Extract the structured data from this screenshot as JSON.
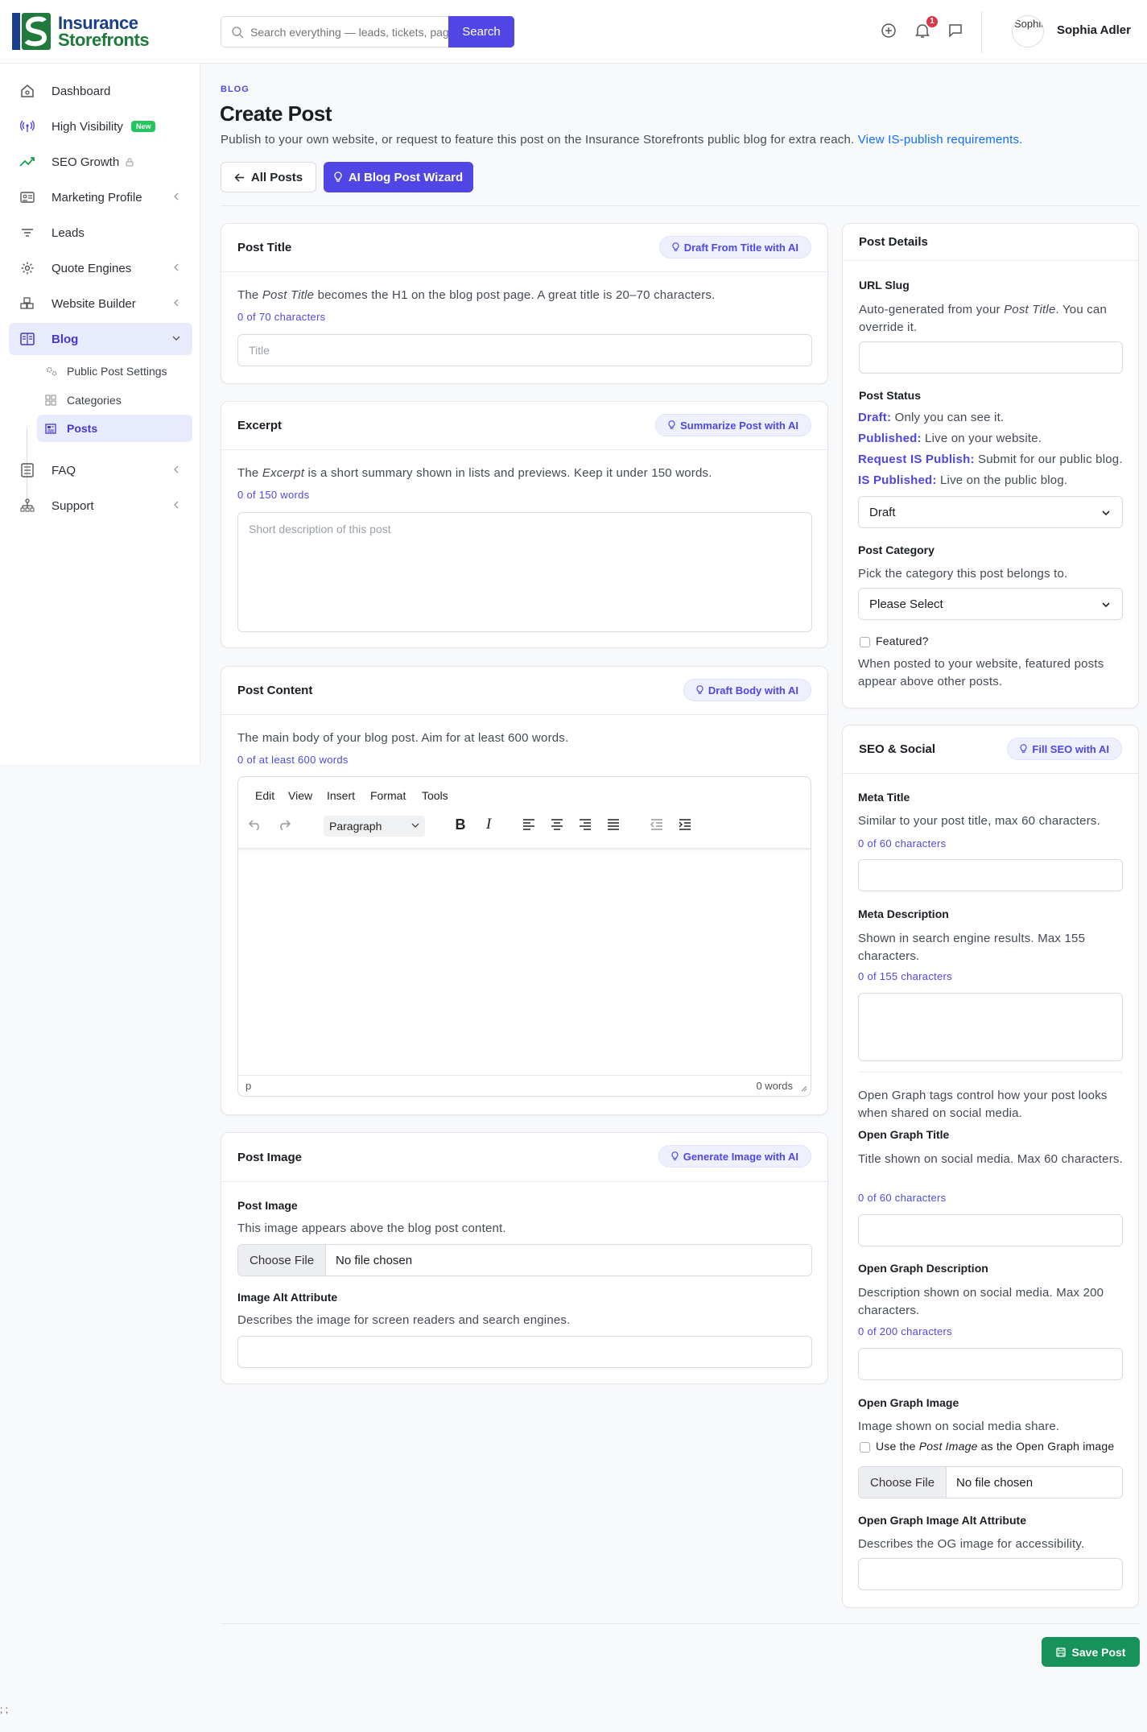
{
  "brand": {
    "line1": "Insurance",
    "line2": "Storefronts",
    "colors": {
      "primary": "#4f46e5",
      "success": "#16925a",
      "danger": "#dc3545"
    }
  },
  "search": {
    "placeholder": "Search everything — leads, tickets, pages...",
    "button": "Search"
  },
  "header": {
    "notification_count": "1",
    "user_name": "Sophia Adler",
    "avatar_alt": "Sophia"
  },
  "sidebar": {
    "items": [
      {
        "label": "Dashboard",
        "icon": "home-icon"
      },
      {
        "label": "High Visibility",
        "icon": "broadcast-icon",
        "badge": "New"
      },
      {
        "label": "SEO Growth",
        "icon": "trending-up-icon"
      },
      {
        "label": "Marketing Profile",
        "icon": "id-card-icon"
      },
      {
        "label": "Leads",
        "icon": "filter-icon"
      },
      {
        "label": "Quote Engines",
        "icon": "gear-icon"
      },
      {
        "label": "Website Builder",
        "icon": "cubes-icon"
      },
      {
        "label": "Blog",
        "icon": "book-icon"
      },
      {
        "label": "FAQ",
        "icon": "list-icon"
      },
      {
        "label": "Support",
        "icon": "sitemap-icon"
      }
    ],
    "blog_sub": [
      {
        "label": "Public Post Settings"
      },
      {
        "label": "Categories"
      },
      {
        "label": "Posts"
      }
    ]
  },
  "page": {
    "breadcrumb": "BLOG",
    "title": "Create Post",
    "description": "Publish to your own website, or request to feature this post on the Insurance Storefronts public blog for extra reach.",
    "description_link": "View IS-publish requirements.",
    "btn_all": "All Posts",
    "btn_wizard": "AI Blog Post Wizard"
  },
  "post_title": {
    "header": "Post Title",
    "ai": "Draft From Title with AI",
    "help_pre": "The ",
    "help_em": "Post Title",
    "help_post": " becomes the H1 on the blog post page. A great title is 20–70 characters.",
    "counter": "0 of 70 characters",
    "placeholder": "Title"
  },
  "excerpt": {
    "header": "Excerpt",
    "ai": "Summarize Post with AI",
    "help_pre": "The ",
    "help_em": "Excerpt",
    "help_post": " is a short summary shown in lists and previews. Keep it under 150 words.",
    "counter": "0 of 150 words",
    "placeholder": "Short description of this post"
  },
  "content": {
    "header": "Post Content",
    "ai": "Draft Body with AI",
    "help": "The main body of your blog post. Aim for at least 600 words.",
    "counter": "0 of at least 600 words",
    "menus": [
      "Edit",
      "View",
      "Insert",
      "Format",
      "Tools"
    ],
    "block_format": "Paragraph",
    "path": "p",
    "word_count": "0 words"
  },
  "image": {
    "header": "Post Image",
    "ai": "Generate Image with AI",
    "label": "Post Image",
    "help": "This image appears above the blog post content.",
    "file_button": "Choose File",
    "file_status": "No file chosen",
    "alt_label": "Image Alt Attribute",
    "alt_help": "Describes the image for screen readers and search engines."
  },
  "details": {
    "header": "Post Details",
    "slug_label": "URL Slug",
    "slug_help_pre": "Auto-generated from your ",
    "slug_help_em": "Post Title",
    "slug_help_post": ". You can override it.",
    "status_label": "Post Status",
    "statuses": [
      {
        "k": "Draft:",
        "v": " Only you can see it."
      },
      {
        "k": "Published:",
        "v": " Live on your website."
      },
      {
        "k": "Request IS Publish:",
        "v": " Submit for our public blog."
      },
      {
        "k": "IS Published:",
        "v": " Live on the public blog."
      }
    ],
    "status_value": "Draft",
    "category_label": "Post Category",
    "category_help": "Pick the category this post belongs to.",
    "category_value": "Please Select",
    "featured_label": "Featured?",
    "featured_help": "When posted to your website, featured posts appear above other posts."
  },
  "seo": {
    "header": "SEO & Social",
    "ai": "Fill SEO with AI",
    "meta_title_label": "Meta Title",
    "meta_title_help": "Similar to your post title, max 60 characters.",
    "meta_title_counter": "0 of 60 characters",
    "meta_desc_label": "Meta Description",
    "meta_desc_help": "Shown in search engine results. Max 155 characters.",
    "meta_desc_counter": "0 of 155 characters",
    "og_intro": "Open Graph tags control how your post looks when shared on social media.",
    "og_title_label": "Open Graph Title",
    "og_title_help": "Title shown on social media. Max 60 characters.",
    "og_title_counter": "0 of 60 characters",
    "og_desc_label": "Open Graph Description",
    "og_desc_help": "Description shown on social media. Max 200 characters.",
    "og_desc_counter": "0 of 200 characters",
    "og_image_label": "Open Graph Image",
    "og_image_help": "Image shown on social media share.",
    "og_use_pre": "Use the ",
    "og_use_em": "Post Image",
    "og_use_post": " as the Open Graph image",
    "file_button": "Choose File",
    "file_status": "No file chosen",
    "og_alt_label": "Open Graph Image Alt Attribute",
    "og_alt_help": "Describes the OG image for accessibility."
  },
  "save_button": "Save Post",
  "footer_text": "; ;"
}
